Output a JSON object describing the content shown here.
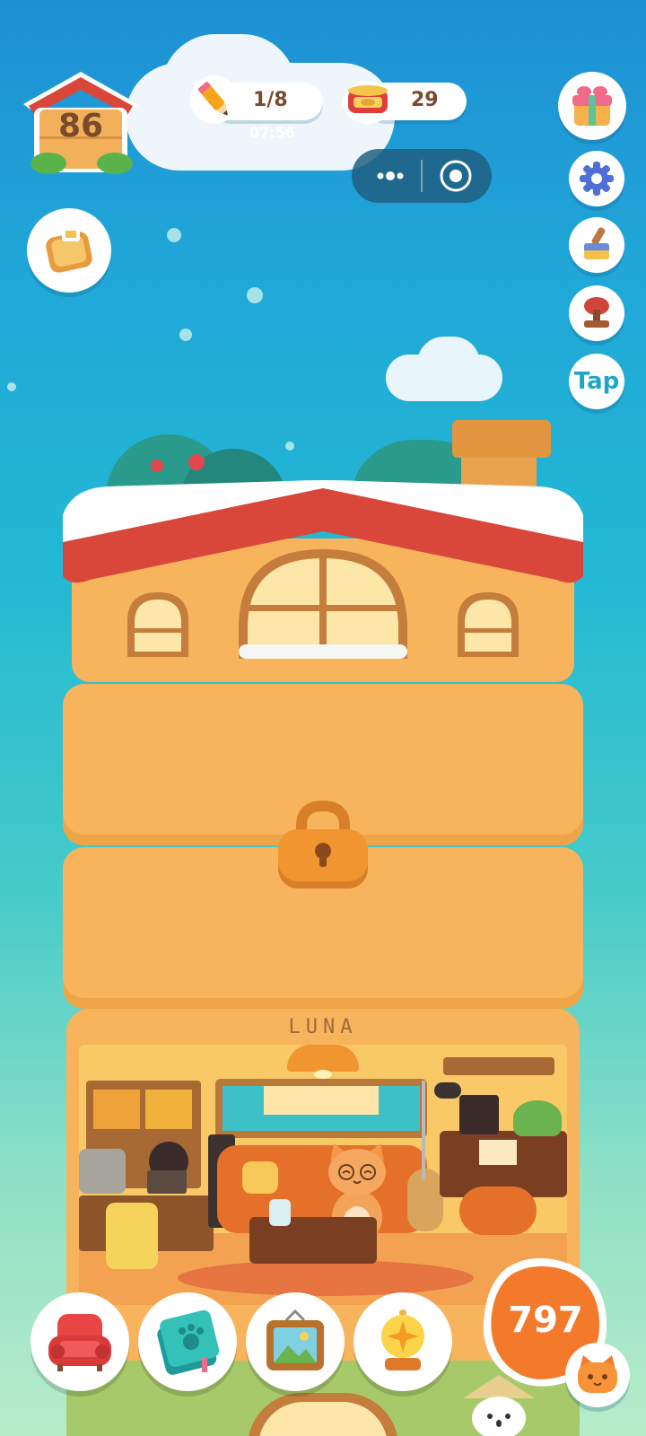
{
  "hud": {
    "level": "86",
    "pencil_count": "1/8",
    "pencil_timer": "07:56",
    "can_count": "29",
    "tap_label": "Tap",
    "coins": "797"
  },
  "house": {
    "room_name": "LUNA"
  },
  "colors": {
    "roof_red": "#d8473a",
    "wall_orange": "#f7b45c",
    "accent_orange": "#f47a2b"
  },
  "icons": {
    "home_badge": "house-icon",
    "pencil": "pencil-icon",
    "cat_food": "cat-food-can-icon",
    "menu": "more-dots-icon",
    "close_target": "target-circle-icon",
    "gift": "gift-box-icon",
    "settings": "gear-icon",
    "decorate": "paint-brush-icon",
    "stamp": "stamp-icon",
    "bread": "bread-toast-icon",
    "lock": "padlock-icon",
    "furniture": "armchair-icon",
    "album": "paw-book-icon",
    "photo": "picture-frame-icon",
    "lamp": "lamp-icon",
    "cat_profile": "cat-face-icon"
  }
}
